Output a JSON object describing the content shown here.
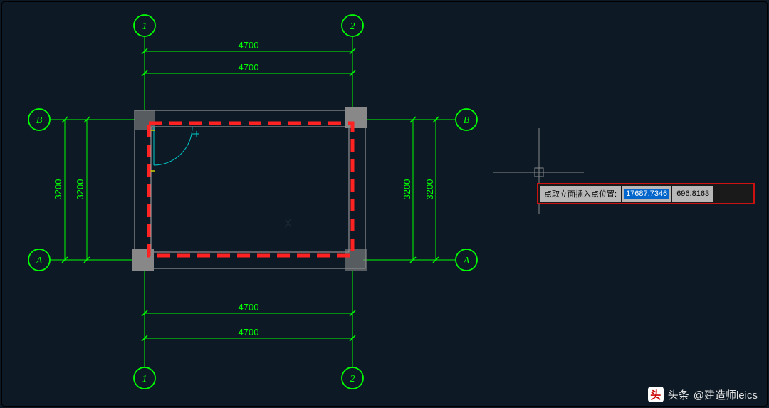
{
  "grid": {
    "axis_x": {
      "1": "1",
      "2": "2"
    },
    "axis_y": {
      "A": "A",
      "B": "B"
    },
    "distance_x": "4700",
    "distance_y": "3200"
  },
  "dimensions": {
    "top_outer": "4700",
    "top_inner": "4700",
    "bottom_inner": "4700",
    "bottom_outer": "4700",
    "left_outer": "3200",
    "left_inner": "3200",
    "right_inner": "3200",
    "right_outer": "3200"
  },
  "input_prompt": {
    "label": "点取立面插入点位置:",
    "x": "17687.7346",
    "y": "696.8163"
  },
  "watermark": "X",
  "attribution": {
    "prefix": "头条",
    "author": "@建造师leics"
  }
}
